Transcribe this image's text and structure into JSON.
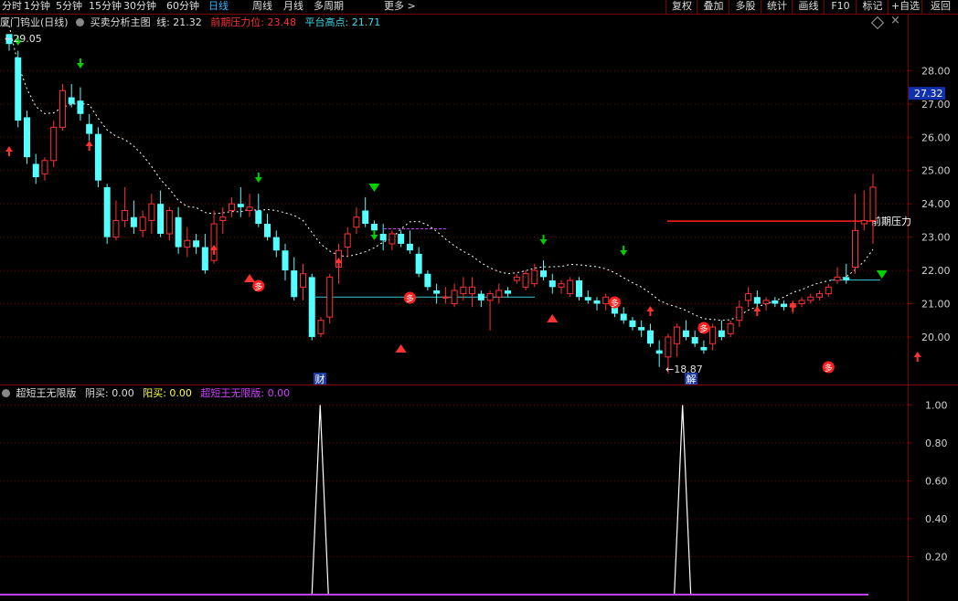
{
  "toolbar": {
    "periods": [
      "分时",
      "1分钟",
      "5分钟",
      "15分钟",
      "30分钟",
      "60分钟",
      "日线",
      "周线",
      "月线",
      "多周期",
      "更多 >"
    ],
    "active_period": "日线",
    "right_buttons": [
      "复权",
      "叠加",
      "多股",
      "统计",
      "画线",
      "F10",
      "标记",
      "+自选",
      "返回"
    ]
  },
  "main_info": {
    "title": "厦门钨业(日线)",
    "indicator": "买卖分析主图",
    "line_label": "线: 21.32",
    "pressure_label": "前期压力位: 23.48",
    "platform_label": "平台高点: 21.71"
  },
  "sub_info": {
    "title": "超短王无限版",
    "yin_label": "阴买: 0.00",
    "yang_label": "阳买: 0.00",
    "ind_label": "超短王无限版: 0.00"
  },
  "price_axis": {
    "ticks": [
      "28.00",
      "27.00",
      "26.00",
      "25.00",
      "24.00",
      "23.00",
      "22.00",
      "21.00",
      "20.00"
    ],
    "current": "27.32"
  },
  "sub_axis": {
    "ticks": [
      "1.00",
      "0.80",
      "0.60",
      "0.40",
      "0.20"
    ]
  },
  "annotations": {
    "high": "29.05",
    "low": "18.87",
    "pressure_text": "前期压力",
    "cai": "财",
    "jie": "解",
    "duo": "多"
  },
  "colors": {
    "up": "#ff3232",
    "down": "#54ffff",
    "grid": "#7a0000",
    "buy_arrow": "#00d000",
    "ma": "#ffffff",
    "pressure": "#ff2020",
    "platform": "#3cc8d8",
    "purple": "#c040ff"
  },
  "chart_data": {
    "type": "candlestick",
    "ylim": [
      18.6,
      29.3
    ],
    "candles": [
      [
        29.1,
        29.0,
        28.6,
        28.8
      ],
      [
        28.4,
        28.6,
        26.3,
        26.5
      ],
      [
        26.6,
        26.8,
        25.2,
        25.4
      ],
      [
        25.2,
        25.5,
        24.6,
        24.8
      ],
      [
        24.9,
        25.4,
        24.7,
        25.3
      ],
      [
        25.3,
        26.5,
        25.1,
        26.3
      ],
      [
        26.3,
        27.6,
        26.2,
        27.4
      ],
      [
        27.2,
        27.6,
        26.9,
        27.0
      ],
      [
        27.1,
        27.5,
        26.5,
        26.7
      ],
      [
        26.4,
        26.7,
        25.9,
        26.1
      ],
      [
        26.1,
        26.3,
        24.5,
        24.7
      ],
      [
        24.5,
        24.6,
        22.8,
        23.0
      ],
      [
        23.0,
        24.1,
        22.9,
        23.5
      ],
      [
        23.5,
        24.5,
        23.3,
        23.8
      ],
      [
        23.6,
        24.1,
        23.1,
        23.3
      ],
      [
        23.2,
        23.8,
        23.0,
        23.6
      ],
      [
        23.5,
        24.3,
        23.1,
        24.0
      ],
      [
        24.0,
        24.4,
        23.0,
        23.1
      ],
      [
        23.1,
        23.9,
        22.9,
        23.8
      ],
      [
        23.6,
        23.9,
        22.5,
        22.7
      ],
      [
        22.7,
        23.3,
        22.4,
        22.9
      ],
      [
        22.9,
        23.1,
        22.5,
        22.7
      ],
      [
        22.7,
        23.1,
        21.9,
        22.0
      ],
      [
        22.3,
        23.8,
        22.2,
        23.4
      ],
      [
        23.5,
        23.9,
        23.1,
        23.6
      ],
      [
        23.8,
        24.2,
        23.6,
        24.0
      ],
      [
        24.0,
        24.5,
        23.6,
        23.9
      ],
      [
        23.8,
        24.3,
        23.6,
        23.9
      ],
      [
        23.8,
        24.3,
        23.3,
        23.4
      ],
      [
        23.4,
        23.7,
        22.9,
        23.0
      ],
      [
        23.0,
        23.2,
        22.4,
        22.6
      ],
      [
        22.6,
        22.8,
        21.7,
        22.0
      ],
      [
        22.0,
        22.4,
        21.1,
        21.2
      ],
      [
        21.5,
        22.2,
        21.1,
        21.9
      ],
      [
        21.8,
        21.9,
        19.9,
        20.0
      ],
      [
        20.1,
        20.6,
        20.0,
        20.5
      ],
      [
        20.6,
        21.9,
        20.4,
        21.8
      ],
      [
        22.1,
        22.8,
        21.6,
        22.6
      ],
      [
        22.7,
        23.3,
        22.4,
        23.1
      ],
      [
        23.3,
        23.9,
        23.1,
        23.6
      ],
      [
        23.8,
        24.2,
        23.3,
        23.4
      ],
      [
        23.4,
        23.5,
        23.0,
        23.2
      ],
      [
        23.1,
        23.4,
        22.6,
        22.9
      ],
      [
        22.8,
        23.2,
        22.6,
        23.1
      ],
      [
        23.1,
        23.2,
        22.7,
        22.8
      ],
      [
        22.8,
        23.2,
        22.5,
        22.6
      ],
      [
        22.5,
        22.7,
        21.8,
        21.9
      ],
      [
        21.9,
        22.0,
        21.4,
        21.5
      ],
      [
        21.4,
        21.6,
        21.0,
        21.3
      ],
      [
        21.2,
        21.5,
        21.0,
        21.2
      ],
      [
        21.0,
        21.6,
        20.9,
        21.4
      ],
      [
        21.3,
        21.8,
        21.1,
        21.5
      ],
      [
        21.3,
        21.8,
        20.9,
        21.5
      ],
      [
        21.3,
        21.4,
        20.9,
        21.1
      ],
      [
        21.1,
        21.4,
        20.2,
        21.3
      ],
      [
        21.2,
        21.6,
        21.0,
        21.4
      ],
      [
        21.4,
        21.5,
        21.2,
        21.3
      ],
      [
        21.7,
        21.9,
        21.6,
        21.8
      ],
      [
        21.5,
        22.0,
        21.4,
        21.9
      ],
      [
        21.6,
        22.2,
        21.5,
        22.0
      ],
      [
        22.0,
        22.3,
        21.7,
        21.8
      ],
      [
        21.7,
        21.9,
        21.3,
        21.5
      ],
      [
        21.5,
        21.7,
        21.3,
        21.6
      ],
      [
        21.3,
        21.8,
        21.2,
        21.7
      ],
      [
        21.7,
        21.8,
        21.1,
        21.2
      ],
      [
        21.2,
        21.4,
        21.0,
        21.1
      ],
      [
        21.1,
        21.2,
        20.8,
        21.0
      ],
      [
        21.0,
        21.3,
        20.8,
        21.2
      ],
      [
        21.1,
        21.2,
        20.6,
        20.7
      ],
      [
        20.7,
        20.9,
        20.4,
        20.5
      ],
      [
        20.5,
        20.6,
        20.2,
        20.3
      ],
      [
        20.3,
        20.5,
        20.0,
        20.2
      ],
      [
        20.2,
        20.4,
        19.7,
        19.8
      ],
      [
        19.6,
        19.9,
        19.1,
        19.5
      ],
      [
        19.4,
        20.1,
        18.9,
        20.0
      ],
      [
        19.8,
        20.4,
        19.4,
        20.3
      ],
      [
        20.2,
        20.5,
        19.9,
        20.0
      ],
      [
        20.0,
        20.2,
        19.7,
        19.8
      ],
      [
        19.7,
        19.9,
        19.5,
        19.6
      ],
      [
        19.8,
        20.4,
        19.6,
        20.3
      ],
      [
        20.2,
        20.5,
        19.9,
        20.0
      ],
      [
        20.1,
        20.5,
        20.0,
        20.4
      ],
      [
        20.5,
        21.1,
        20.3,
        20.9
      ],
      [
        21.1,
        21.5,
        20.9,
        21.3
      ],
      [
        21.2,
        21.4,
        20.9,
        21.0
      ],
      [
        21.0,
        21.2,
        20.8,
        21.1
      ],
      [
        21.1,
        21.2,
        20.9,
        21.0
      ],
      [
        21.0,
        21.1,
        20.8,
        20.9
      ],
      [
        20.9,
        21.1,
        20.7,
        21.0
      ],
      [
        21.0,
        21.2,
        20.9,
        21.1
      ],
      [
        21.1,
        21.3,
        21.0,
        21.2
      ],
      [
        21.2,
        21.4,
        21.1,
        21.3
      ],
      [
        21.3,
        21.6,
        21.2,
        21.5
      ],
      [
        21.7,
        22.1,
        21.6,
        21.8
      ],
      [
        21.8,
        22.2,
        21.6,
        21.7
      ],
      [
        22.1,
        24.3,
        21.9,
        23.2
      ],
      [
        23.4,
        24.4,
        23.2,
        23.5
      ],
      [
        23.5,
        24.9,
        22.8,
        24.5
      ]
    ],
    "sub_series": {
      "name": "超短王无限版",
      "spikes_at_index": [
        34,
        75
      ],
      "value": 1.0,
      "ylim": [
        0,
        1.05
      ]
    }
  }
}
